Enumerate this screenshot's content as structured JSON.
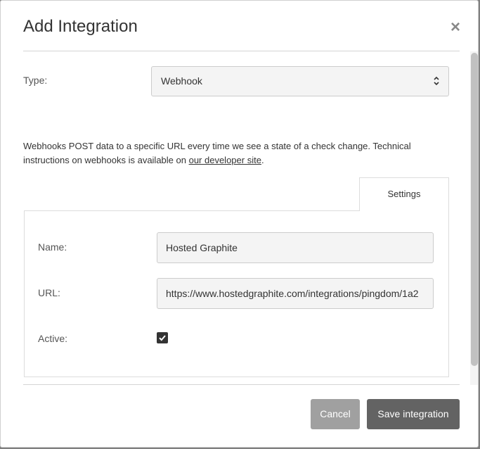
{
  "dialog": {
    "title": "Add Integration",
    "close_glyph": "×"
  },
  "type_field": {
    "label": "Type:",
    "selected": "Webhook"
  },
  "description": {
    "text_before": "Webhooks POST data to a specific URL every time we see a state of a check change. Technical instructions on webhooks is available on ",
    "link_text": "our developer site",
    "text_after": "."
  },
  "tabs": [
    {
      "label": "Settings",
      "active": true
    }
  ],
  "settings": {
    "name_label": "Name:",
    "name_value": "Hosted Graphite",
    "url_label": "URL:",
    "url_value": "https://www.hostedgraphite.com/integrations/pingdom/1a2",
    "active_label": "Active:",
    "active_checked": true
  },
  "buttons": {
    "cancel": "Cancel",
    "save": "Save integration"
  },
  "colors": {
    "save_button": "#636363",
    "cancel_button": "#a0a0a0",
    "backdrop": "#7f7f7f"
  },
  "icons": {
    "close": "close-icon",
    "select_arrows": "select-arrows-icon",
    "checkmark": "checkmark-icon"
  }
}
